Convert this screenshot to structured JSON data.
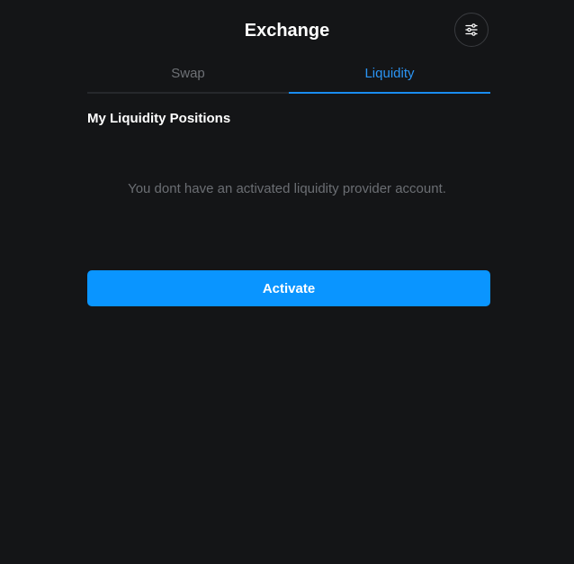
{
  "header": {
    "title": "Exchange",
    "settings_icon": "sliders-icon"
  },
  "tabs": [
    {
      "label": "Swap",
      "active": false
    },
    {
      "label": "Liquidity",
      "active": true
    }
  ],
  "liquidity": {
    "section_title": "My Liquidity Positions",
    "empty_message": "You dont have an activated liquidity provider account.",
    "activate_label": "Activate"
  },
  "colors": {
    "background": "#141517",
    "accent": "#0a95ff",
    "active_tab_text": "#2b95f5",
    "inactive_tab_text": "#6e7176",
    "muted_text": "#6b6e73"
  }
}
